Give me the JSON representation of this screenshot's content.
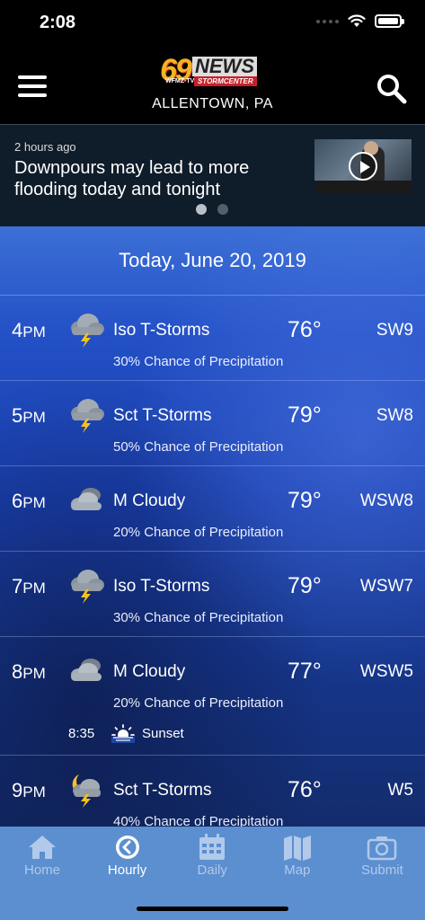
{
  "status_bar": {
    "time": "2:08"
  },
  "header": {
    "logo": {
      "number": "69",
      "brand": "NEWS",
      "station": "WFMZ-TV",
      "sub_brand": "STORMCENTER"
    },
    "location": "ALLENTOWN, PA"
  },
  "news": {
    "time_ago": "2 hours ago",
    "headline": "Downpours may lead to more flooding today and tonight",
    "page_count": 2,
    "active_page": 1
  },
  "forecast": {
    "date": "Today, June 20, 2019",
    "hours": [
      {
        "hour": "4",
        "ampm": "PM",
        "icon": "storm-cloud-icon",
        "condition": "Iso T-Storms",
        "temp": "76°",
        "wind": "SW9",
        "precip": "30% Chance of Precipitation"
      },
      {
        "hour": "5",
        "ampm": "PM",
        "icon": "storm-cloud-icon",
        "condition": "Sct T-Storms",
        "temp": "79°",
        "wind": "SW8",
        "precip": "50% Chance of Precipitation"
      },
      {
        "hour": "6",
        "ampm": "PM",
        "icon": "cloudy-icon",
        "condition": "M Cloudy",
        "temp": "79°",
        "wind": "WSW8",
        "precip": "20% Chance of Precipitation"
      },
      {
        "hour": "7",
        "ampm": "PM",
        "icon": "storm-cloud-icon",
        "condition": "Iso T-Storms",
        "temp": "79°",
        "wind": "WSW7",
        "precip": "30% Chance of Precipitation"
      },
      {
        "hour": "8",
        "ampm": "PM",
        "icon": "cloudy-icon",
        "condition": "M Cloudy",
        "temp": "77°",
        "wind": "WSW5",
        "precip": "20% Chance of Precipitation",
        "sunset": {
          "time": "8:35",
          "label": "Sunset"
        }
      },
      {
        "hour": "9",
        "ampm": "PM",
        "icon": "night-storm-icon",
        "condition": "Sct T-Storms",
        "temp": "76°",
        "wind": "W5",
        "precip": "40% Chance of Precipitation"
      }
    ]
  },
  "tabs": [
    {
      "label": "Home",
      "icon": "home-icon",
      "active": false
    },
    {
      "label": "Hourly",
      "icon": "clock-icon",
      "active": true
    },
    {
      "label": "Daily",
      "icon": "calendar-icon",
      "active": false
    },
    {
      "label": "Map",
      "icon": "map-icon",
      "active": false
    },
    {
      "label": "Submit",
      "icon": "camera-icon",
      "active": false
    }
  ],
  "colors": {
    "tabbar": "#5b8fd0",
    "tab_inactive": "#b2c9ea",
    "tab_active": "#ffffff",
    "forecast_blue": "#2350c6"
  }
}
